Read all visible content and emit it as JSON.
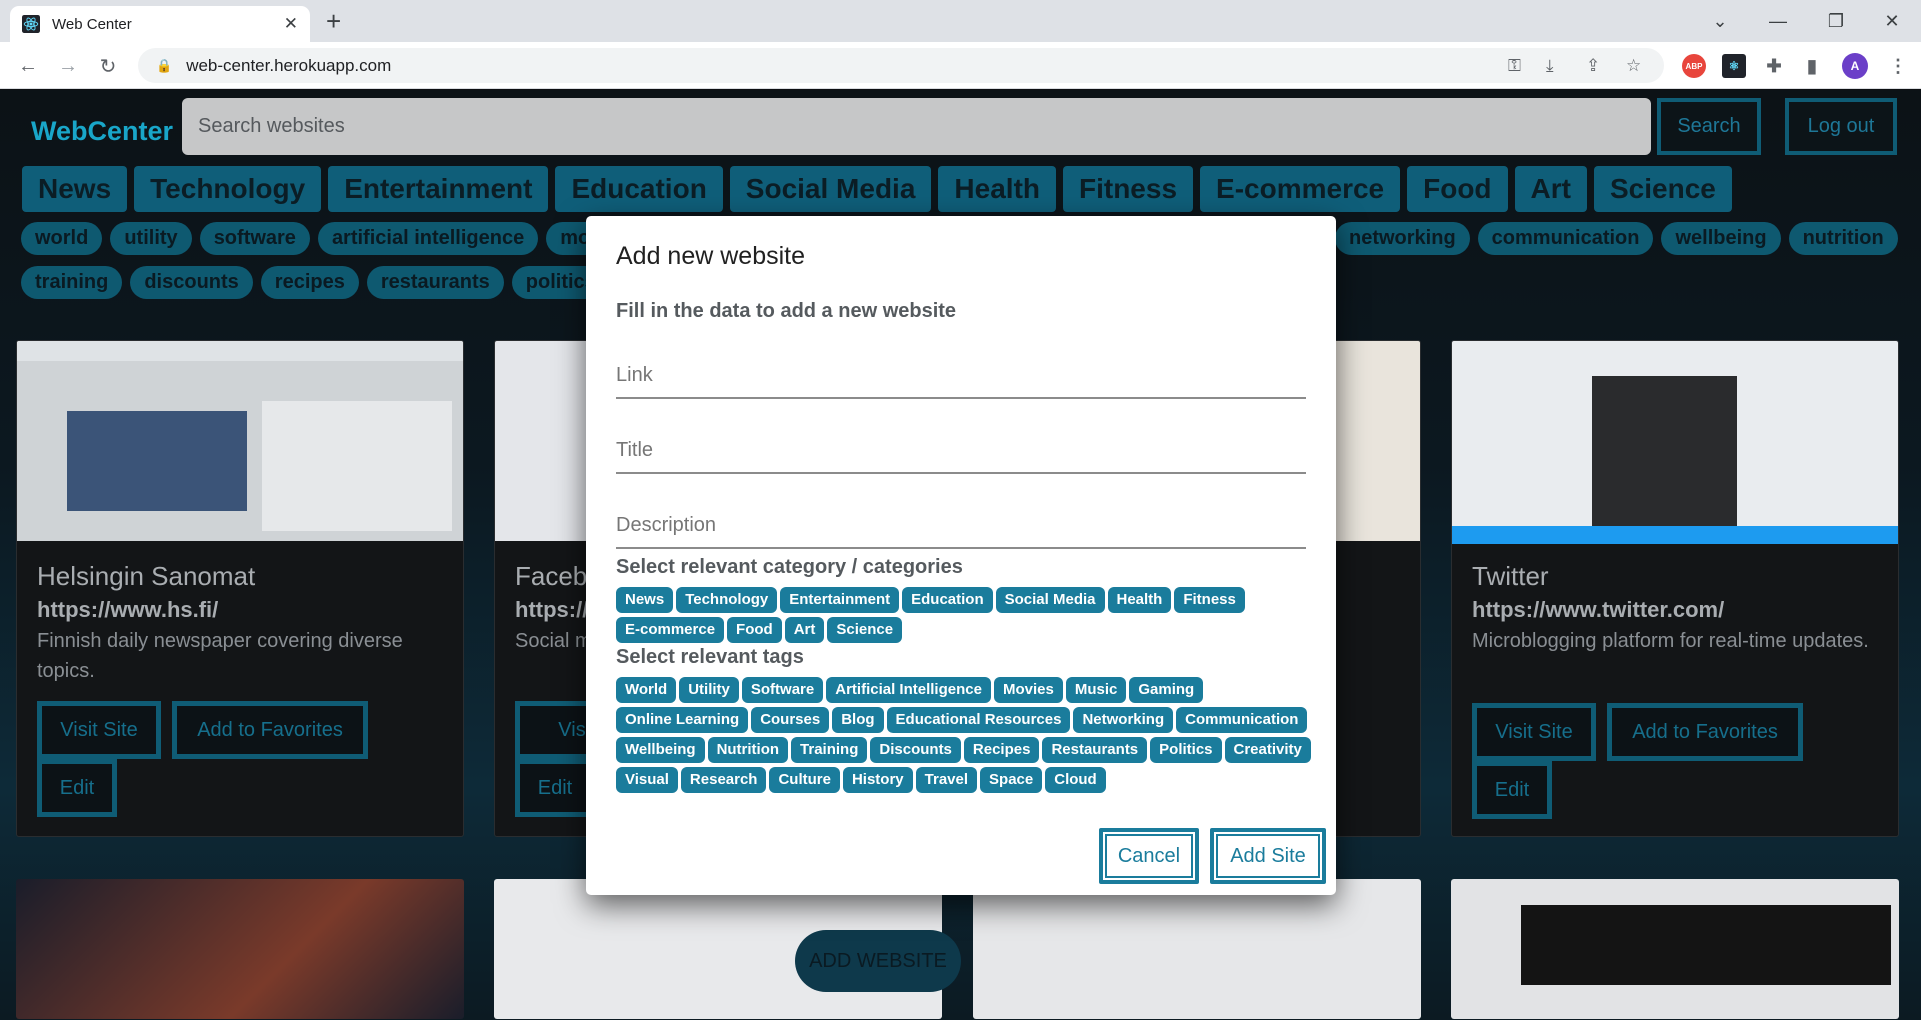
{
  "browser": {
    "tab_title": "Web Center",
    "url": "web-center.herokuapp.com",
    "profile_initial": "A",
    "abp_label": "ABP"
  },
  "header": {
    "logo": "WebCenter",
    "search_placeholder": "Search websites",
    "search_button": "Search",
    "logout_button": "Log out"
  },
  "categories": [
    "News",
    "Technology",
    "Entertainment",
    "Education",
    "Social Media",
    "Health",
    "Fitness",
    "E-commerce",
    "Food",
    "Art",
    "Science"
  ],
  "tags_row1_left": [
    "world",
    "utility",
    "software",
    "artificial intelligence",
    "movies"
  ],
  "tags_row1_right": [
    "networking",
    "communication",
    "wellbeing",
    "nutrition"
  ],
  "tags_row2": [
    "training",
    "discounts",
    "recipes",
    "restaurants",
    "politics",
    "cr"
  ],
  "cards": [
    {
      "title": "Helsingin Sanomat",
      "url": "https://www.hs.fi/",
      "desc": "Finnish daily newspaper covering diverse topics.",
      "visit": "Visit Site",
      "fav": "Add to Favorites",
      "edit": "Edit"
    },
    {
      "title": "Facebo",
      "url": "https://v",
      "desc": "Social m sharing.",
      "visit": "Visit",
      "edit": "Edit"
    },
    {
      "title": "Twitter",
      "url": "https://www.twitter.com/",
      "desc": "Microblogging platform for real-time updates.",
      "visit": "Visit Site",
      "fav": "Add to Favorites",
      "edit": "Edit"
    }
  ],
  "add_website_fab": "ADD WEBSITE",
  "modal": {
    "title": "Add new website",
    "subtitle": "Fill in the data to add a new website",
    "link_placeholder": "Link",
    "title_placeholder": "Title",
    "description_placeholder": "Description",
    "categories_heading": "Select relevant category / categories",
    "categories": [
      "News",
      "Technology",
      "Entertainment",
      "Education",
      "Social Media",
      "Health",
      "Fitness",
      "E-commerce",
      "Food",
      "Art",
      "Science"
    ],
    "tags_heading": "Select relevant tags",
    "tags": [
      "World",
      "Utility",
      "Software",
      "Artificial Intelligence",
      "Movies",
      "Music",
      "Gaming",
      "Online Learning",
      "Courses",
      "Blog",
      "Educational Resources",
      "Networking",
      "Communication",
      "Wellbeing",
      "Nutrition",
      "Training",
      "Discounts",
      "Recipes",
      "Restaurants",
      "Politics",
      "Creativity",
      "Visual",
      "Research",
      "Culture",
      "History",
      "Travel",
      "Space",
      "Cloud"
    ],
    "cancel": "Cancel",
    "add_site": "Add Site"
  }
}
